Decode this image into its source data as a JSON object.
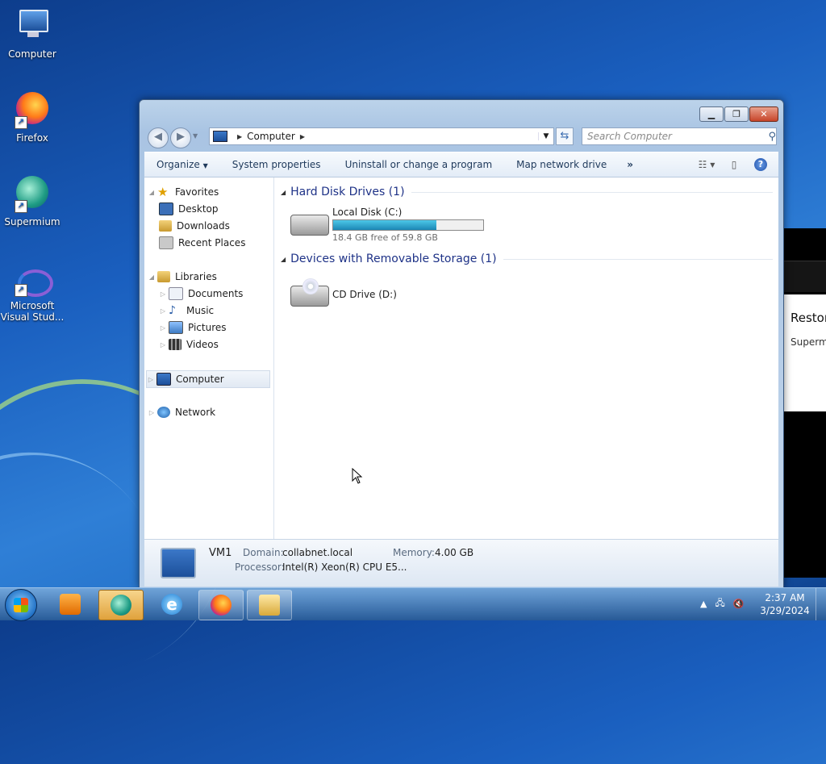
{
  "desktop": {
    "icons": [
      {
        "label": "Computer"
      },
      {
        "label": "Firefox"
      },
      {
        "label": "Supermium"
      },
      {
        "label": "Microsoft Visual Stud..."
      }
    ]
  },
  "background_window": {
    "title": "Restor",
    "subtitle": "Superm"
  },
  "explorer": {
    "address": {
      "crumb": "Computer"
    },
    "search": {
      "placeholder": "Search Computer"
    },
    "toolbar": {
      "organize": "Organize",
      "system_properties": "System properties",
      "uninstall": "Uninstall or change a program",
      "map_drive": "Map network drive",
      "more": "»"
    },
    "nav": {
      "favorites": "Favorites",
      "desktop": "Desktop",
      "downloads": "Downloads",
      "recent": "Recent Places",
      "libraries": "Libraries",
      "documents": "Documents",
      "music": "Music",
      "pictures": "Pictures",
      "videos": "Videos",
      "computer": "Computer",
      "network": "Network"
    },
    "groups": {
      "hdd": "Hard Disk Drives (1)",
      "removable": "Devices with Removable Storage (1)"
    },
    "drives": {
      "c": {
        "name": "Local Disk (C:)",
        "size": "18.4 GB free of 59.8 GB",
        "used_fraction": 0.69
      },
      "d": {
        "name": "CD Drive (D:)"
      }
    },
    "details": {
      "name": "VM1",
      "domain_label": "Domain:",
      "domain": "collabnet.local",
      "memory_label": "Memory:",
      "memory": "4.00 GB",
      "processor_label": "Processor:",
      "processor": "Intel(R) Xeon(R) CPU E5..."
    }
  },
  "taskbar": {
    "time": "2:37 AM",
    "date": "3/29/2024"
  },
  "colors": {
    "accent": "#1e3287",
    "taskbar_active": "#e0a23c"
  }
}
